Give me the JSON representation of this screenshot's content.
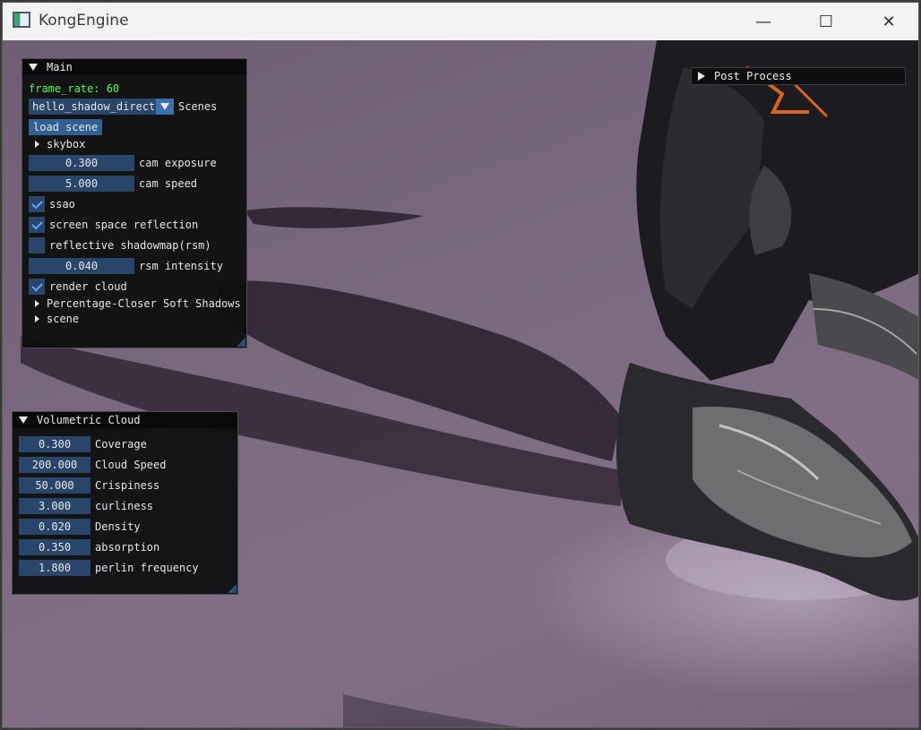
{
  "window": {
    "title": "KongEngine",
    "minimize_glyph": "—",
    "maximize_glyph": "☐",
    "close_glyph": "✕"
  },
  "main_panel": {
    "title": "Main",
    "frame_rate": "frame_rate: 60",
    "scene_combo_value": "hello_shadow_directi",
    "scene_combo_label": "Scenes",
    "load_scene_button": "load scene",
    "skybox_label": "skybox",
    "cam_exposure_value": "0.300",
    "cam_exposure_label": "cam exposure",
    "cam_speed_value": "5.000",
    "cam_speed_label": "cam speed",
    "ssao_label": "ssao",
    "ssao_checked": true,
    "ssr_label": "screen space reflection",
    "ssr_checked": true,
    "rsm_label": "reflective shadowmap(rsm)",
    "rsm_checked": false,
    "rsm_intensity_value": "0.040",
    "rsm_intensity_label": "rsm intensity",
    "render_cloud_label": "render cloud",
    "render_cloud_checked": true,
    "pcss_label": "Percentage-Closer Soft Shadows",
    "scene_label": "scene"
  },
  "post_process_panel": {
    "title": "Post Process"
  },
  "cloud_panel": {
    "title": "Volumetric Cloud",
    "fields": [
      {
        "value": "0.300",
        "label": "Coverage"
      },
      {
        "value": "200.000",
        "label": "Cloud Speed"
      },
      {
        "value": "50.000",
        "label": "Crispiness"
      },
      {
        "value": "3.000",
        "label": "curliness"
      },
      {
        "value": "0.020",
        "label": "Density"
      },
      {
        "value": "0.350",
        "label": "absorption"
      },
      {
        "value": "1.800",
        "label": "perlin frequency"
      }
    ]
  },
  "colors": {
    "frame_rate_text": "#4cff4c",
    "field_bg": "#29456a",
    "checkmark": "#5aa3ff",
    "panel_bg": "#0e0e0e"
  }
}
